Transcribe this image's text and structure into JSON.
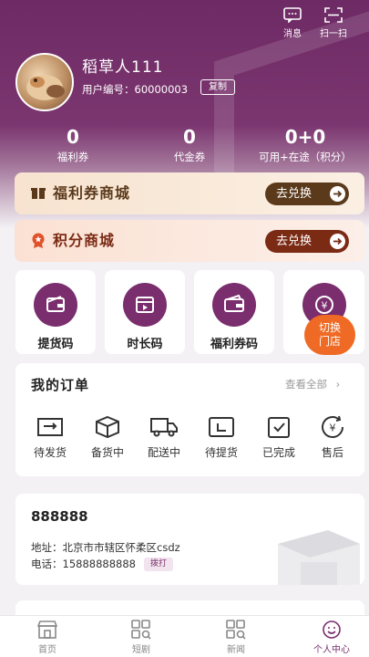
{
  "header": {
    "message_label": "消息",
    "scan_label": "扫一扫"
  },
  "user": {
    "name": "稻草人111",
    "id_label": "用户编号：",
    "id_value": "60000003",
    "copy_label": "复制"
  },
  "stats": [
    {
      "value": "0",
      "label": "福利券"
    },
    {
      "value": "0",
      "label": "代金券"
    },
    {
      "value": "0+0",
      "label": "可用+在途（积分）"
    }
  ],
  "welfare_mall": {
    "title": "福利券商城",
    "button": "去兑换",
    "icon": "gift-box-icon",
    "color": "#5b3a1c"
  },
  "points_mall": {
    "title": "积分商城",
    "button": "去兑换",
    "icon": "medal-icon",
    "color": "#7b2a14"
  },
  "tiles": [
    {
      "label": "提货码",
      "icon": "wallet-card-icon"
    },
    {
      "label": "时长码",
      "icon": "video-clapper-icon"
    },
    {
      "label": "福利券码",
      "icon": "wallet-icon"
    },
    {
      "label": "",
      "icon": "yen-coin-icon"
    }
  ],
  "switch_store": {
    "line1": "切换",
    "line2": "门店"
  },
  "orders": {
    "title": "我的订单",
    "see_all": "查看全部",
    "items": [
      {
        "label": "待发货",
        "icon": "pending-ship-icon"
      },
      {
        "label": "备货中",
        "icon": "box-icon"
      },
      {
        "label": "配送中",
        "icon": "truck-icon"
      },
      {
        "label": "待提货",
        "icon": "pickup-icon"
      },
      {
        "label": "已完成",
        "icon": "clipboard-check-icon"
      },
      {
        "label": "售后",
        "icon": "after-sale-icon"
      }
    ]
  },
  "store": {
    "name": "888888",
    "address": "地址：北京市市辖区怀柔区csdz",
    "phone": "电话：15888888888",
    "dial_label": "拨打"
  },
  "tabbar": [
    {
      "label": "首页",
      "icon": "shop-icon"
    },
    {
      "label": "短剧",
      "icon": "grid-search-icon"
    },
    {
      "label": "新闻",
      "icon": "grid-search-icon"
    },
    {
      "label": "个人中心",
      "icon": "smile-icon",
      "active": true
    }
  ],
  "colors": {
    "brand": "#7a2e6d",
    "accent": "#ef6a24"
  }
}
